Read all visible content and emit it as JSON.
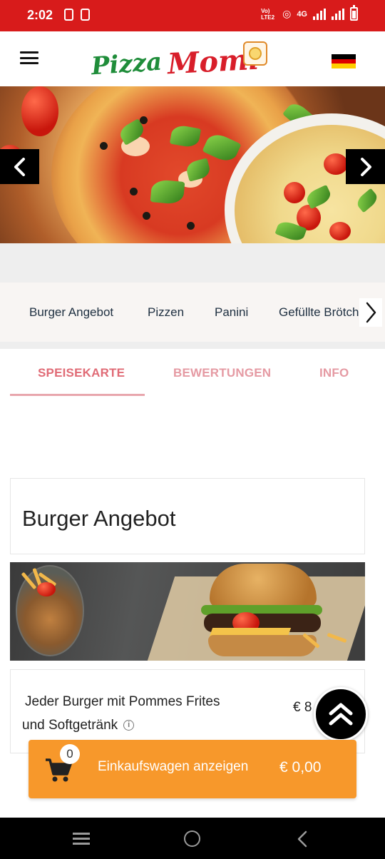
{
  "status_bar": {
    "time": "2:02",
    "network": "4G",
    "carrier_tag": "Vo) LTE2"
  },
  "header": {
    "logo_word1": "Pizza",
    "logo_word2": "Momi",
    "language_flag": "german-flag-icon",
    "flag_colors": [
      "#000000",
      "#dd0000",
      "#ffce00"
    ]
  },
  "categories": [
    "Burger Angebot",
    "Pizzen",
    "Panini",
    "Gefüllte Brötch"
  ],
  "tabs": [
    {
      "label": "SPEISEKARTE",
      "active": true
    },
    {
      "label": "BEWERTUNGEN",
      "active": false
    },
    {
      "label": "INFO",
      "active": false
    }
  ],
  "menu_section": {
    "title": "Burger Angebot",
    "items": [
      {
        "name_line1": "Jeder Burger mit Pommes Frites",
        "name_line2": "und Softgetränk",
        "price": "€ 8"
      }
    ]
  },
  "cart": {
    "count": "0",
    "label": "Einkaufswagen anzeigen",
    "total": "€ 0,00"
  },
  "colors": {
    "status_bar": "#d81b1b",
    "accent_tab": "#e06b76",
    "cart": "#f7982b"
  }
}
